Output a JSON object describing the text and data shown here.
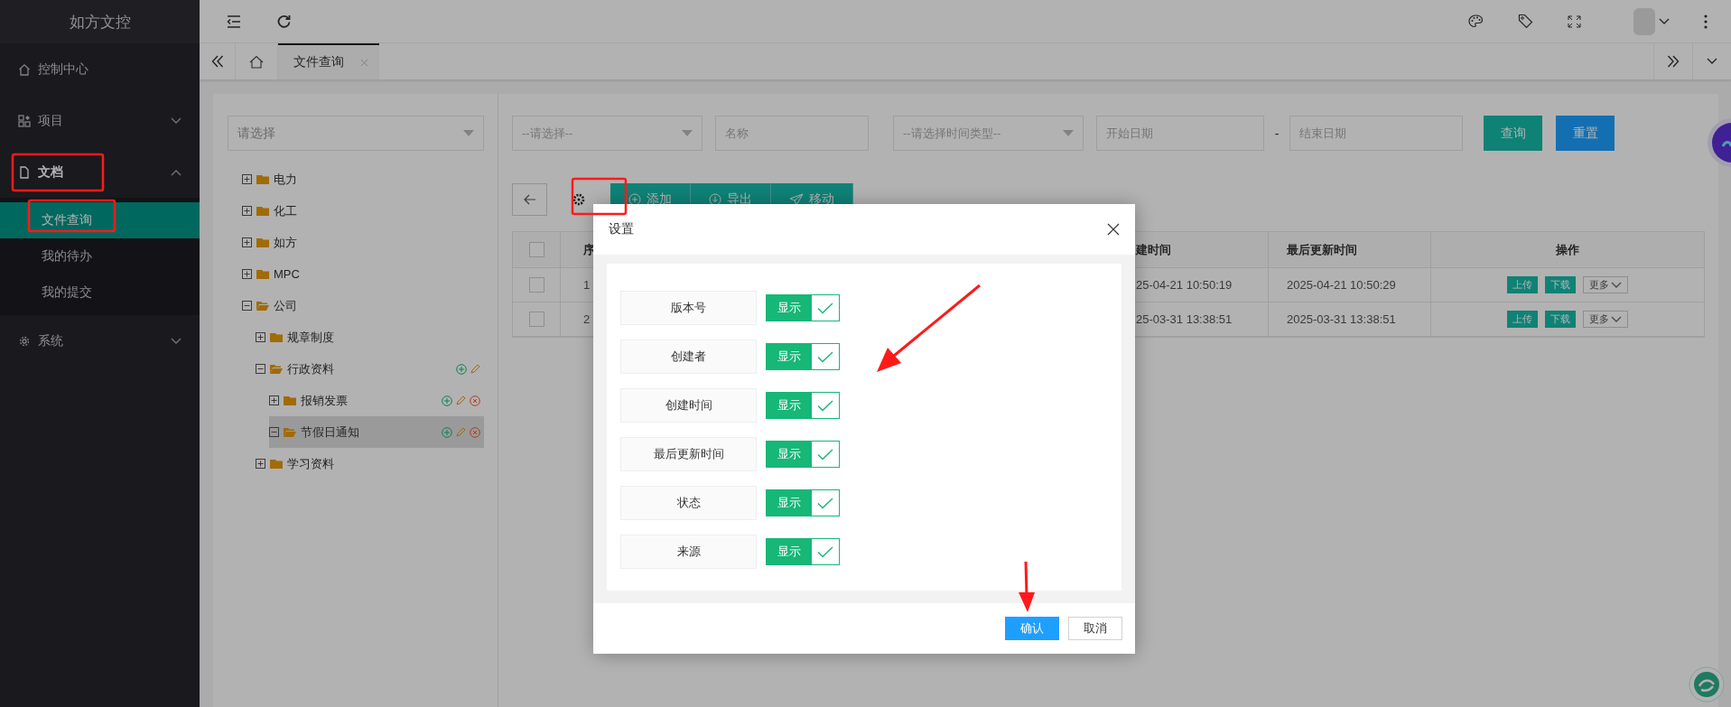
{
  "app": {
    "title": "如方文控"
  },
  "sidebar": {
    "items": [
      {
        "label": "控制中心",
        "selected": false
      },
      {
        "label": "项目",
        "selected": false,
        "expanded": false
      },
      {
        "label": "文档",
        "selected": true,
        "expanded": true,
        "children": [
          {
            "label": "文件查询",
            "selected": true
          },
          {
            "label": "我的待办",
            "selected": false
          },
          {
            "label": "我的提交",
            "selected": false
          }
        ]
      },
      {
        "label": "系统",
        "selected": false,
        "expanded": false
      }
    ]
  },
  "tabs": [
    {
      "label": "文件查询",
      "selected": true
    }
  ],
  "tree": {
    "placeholder": "请选择",
    "nodes": [
      {
        "label": "电力",
        "expanded": false,
        "selected": false
      },
      {
        "label": "化工",
        "expanded": false,
        "selected": false
      },
      {
        "label": "如方",
        "expanded": false,
        "selected": false
      },
      {
        "label": "MPC",
        "expanded": false,
        "selected": false
      },
      {
        "label": "公司",
        "expanded": true,
        "selected": false,
        "children": [
          {
            "label": "规章制度",
            "expanded": false,
            "selected": false
          },
          {
            "label": "行政资料",
            "expanded": true,
            "selected": false,
            "addable": true,
            "editable": true,
            "children": [
              {
                "label": "报销发票",
                "expanded": false,
                "selected": false,
                "addable": true,
                "editable": true,
                "deletable": true
              },
              {
                "label": "节假日通知",
                "expanded": true,
                "selected": true,
                "addable": true,
                "editable": true,
                "deletable": true
              }
            ]
          },
          {
            "label": "学习资料",
            "expanded": false,
            "selected": false
          }
        ]
      }
    ]
  },
  "filters": [
    {
      "kind": "select",
      "placeholder": "--请选择--"
    },
    {
      "kind": "input",
      "placeholder": "名称"
    },
    {
      "kind": "select",
      "placeholder": "--请选择时间类型--"
    },
    {
      "kind": "input",
      "placeholder": "开始日期"
    },
    {
      "kind": "separator",
      "text": "-"
    },
    {
      "kind": "input",
      "placeholder": "结束日期"
    }
  ],
  "filter_buttons": [
    {
      "label": "查询",
      "kind": "search"
    },
    {
      "label": "重置",
      "kind": "reset"
    }
  ],
  "toolbar": {
    "actions": [
      "添加",
      "导出",
      "移动"
    ]
  },
  "table": {
    "all_checked": false,
    "columns": [
      "序",
      "建时间",
      "最后更新时间",
      "操作"
    ],
    "rows": [
      {
        "checked": false,
        "cells": [
          "1",
          "25-04-21 10:50:19",
          "2025-04-21 10:50:29"
        ],
        "actions": [
          "上传",
          "下载",
          "更多"
        ]
      },
      {
        "checked": false,
        "cells": [
          "2",
          "25-03-31 13:38:51",
          "2025-03-31 13:38:51"
        ],
        "actions": [
          "上传",
          "下载",
          "更多"
        ]
      }
    ]
  },
  "dialog": {
    "title": "设置",
    "fields": [
      {
        "label": "版本号",
        "toggle": "显示",
        "on": true
      },
      {
        "label": "创建者",
        "toggle": "显示",
        "on": true
      },
      {
        "label": "创建时间",
        "toggle": "显示",
        "on": true
      },
      {
        "label": "最后更新时间",
        "toggle": "显示",
        "on": true
      },
      {
        "label": "状态",
        "toggle": "显示",
        "on": true
      },
      {
        "label": "来源",
        "toggle": "显示",
        "on": true
      }
    ],
    "buttons": [
      {
        "label": "确认",
        "kind": "primary"
      },
      {
        "label": "取消",
        "kind": "default"
      }
    ]
  }
}
